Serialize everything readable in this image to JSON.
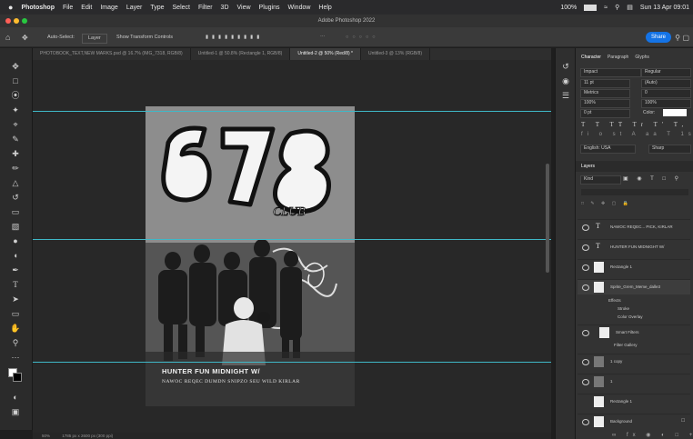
{
  "menubar": {
    "apple": "",
    "app": "Photoshop",
    "items": [
      "File",
      "Edit",
      "Image",
      "Layer",
      "Type",
      "Select",
      "Filter",
      "3D",
      "View",
      "Plugins",
      "Window",
      "Help"
    ],
    "battery": "100%",
    "clock": "Sun 13 Apr 09:01"
  },
  "window": {
    "title": "Adobe Photoshop 2022"
  },
  "options": {
    "auto_select": "Auto-Select:",
    "auto_select_value": "Layer",
    "show_transform": "Show Transform Controls",
    "share": "Share"
  },
  "tabs": [
    "PHOTOBOOK_TEXT,NEW MARKS.psd @ 16.7% (IMG_7318, RGB/8)",
    "Untitled-1 @ 50.8% (Rectangle 1, RGB/8)",
    "Untitled-2 @ 50% (Red/8) *",
    "Untitled-3 @ 13% (RGB/8)"
  ],
  "active_tab": 2,
  "poster": {
    "graffiti": "678",
    "graffiti_sub": "CLUB",
    "line1": "HUNTER FUN MIDNIGHT W/",
    "line2": "NAWOC REQEC DUMDN SNIPZO SEU WILD KIRLAR"
  },
  "status": {
    "zoom": "50%",
    "doc": "1785 px x 2600 px (300 ppi)"
  },
  "character": {
    "tabs": [
      "Character",
      "Paragraph",
      "Glyphs"
    ],
    "font": "Impact",
    "style": "Regular",
    "size": "11 pt",
    "leading": "(Auto)",
    "kerning": "Metrics",
    "tracking": "0",
    "v_scale": "100%",
    "h_scale": "100%",
    "baseline": "0 pt",
    "color_label": "Color:",
    "language": "English: USA",
    "aa": "Sharp"
  },
  "layers": {
    "title": "Layers",
    "filter": "Kind",
    "items": [
      {
        "kind": "text",
        "name": "NAWOC REQEC... PICK, KIRLAR"
      },
      {
        "kind": "text",
        "name": "HUNTER FUN MIDNIGHT W/"
      },
      {
        "kind": "shape",
        "name": "Rectangle 1"
      },
      {
        "kind": "smart",
        "name": "Sprite_Grem_Meme_dalle3"
      },
      {
        "kind": "sub",
        "name": "Effects"
      },
      {
        "kind": "sub",
        "name": "Stroke"
      },
      {
        "kind": "sub",
        "name": "Color Overlay"
      },
      {
        "kind": "sub",
        "name": "Smart Filters"
      },
      {
        "kind": "sub",
        "name": "Filter Gallery"
      },
      {
        "kind": "image",
        "name": "1 copy"
      },
      {
        "kind": "image",
        "name": "1"
      },
      {
        "kind": "shape",
        "name": "Rectangle 1"
      },
      {
        "kind": "image",
        "name": "Background"
      }
    ]
  }
}
